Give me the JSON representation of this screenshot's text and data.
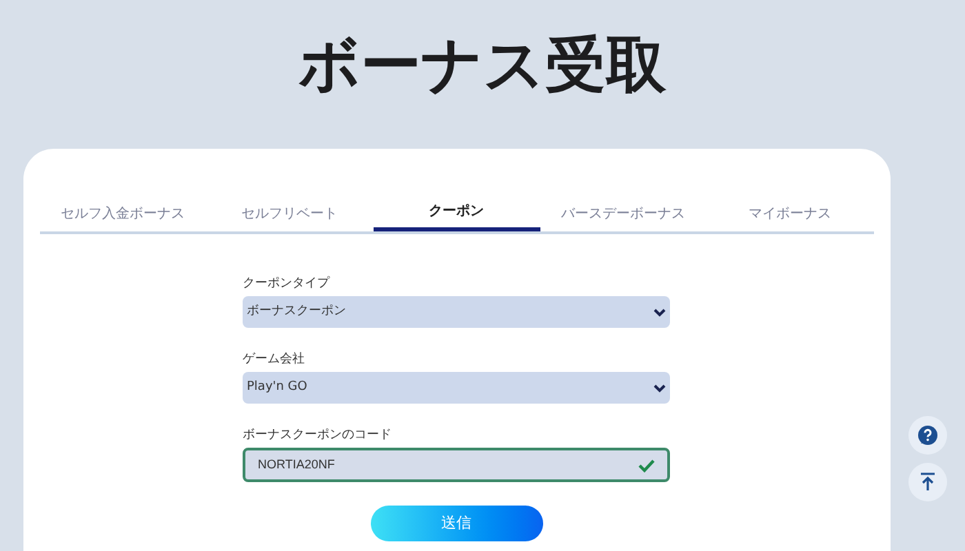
{
  "page_title": "ボーナス受取",
  "tabs": [
    {
      "label": "セルフ入金ボーナス",
      "selected": false
    },
    {
      "label": "セルフリベート",
      "selected": false
    },
    {
      "label": "クーポン",
      "selected": true
    },
    {
      "label": "バースデーボーナス",
      "selected": false
    },
    {
      "label": "マイボーナス",
      "selected": false
    }
  ],
  "fields": [
    {
      "kind": "select",
      "label": "クーポンタイプ",
      "value": "ボーナスクーポン"
    },
    {
      "kind": "select",
      "label": "ゲーム会社",
      "value": "Play'n GO"
    },
    {
      "kind": "text",
      "label": "ボーナスクーポンのコード",
      "value": "NORTIA20NF",
      "valid": true
    }
  ],
  "submit_button": "送信"
}
